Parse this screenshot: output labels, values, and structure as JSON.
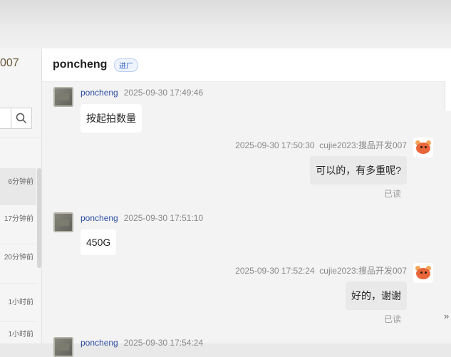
{
  "left_panel": {
    "title_fragment": "007",
    "conversations": [
      {
        "time": "6分钟前"
      },
      {
        "time": "17分钟前"
      },
      {
        "time": "20分钟前"
      },
      {
        "time": "1小时前"
      },
      {
        "time": "1小时前"
      }
    ]
  },
  "chat": {
    "title": "poncheng",
    "badge": "进厂",
    "messages": [
      {
        "sender": "poncheng",
        "time": "2025-09-30 17:49:46",
        "text": "按起拍数量"
      },
      {
        "sender": "cujie2023:搜品开发007",
        "time": "2025-09-30 17:50:30",
        "text": "可以的，有多重呢?",
        "status": "已读"
      },
      {
        "sender": "poncheng",
        "time": "2025-09-30 17:51:10",
        "text": "450G"
      },
      {
        "sender": "cujie2023:搜品开发007",
        "time": "2025-09-30 17:52:24",
        "text": "好的，谢谢",
        "status": "已读"
      },
      {
        "sender": "poncheng",
        "time": "2025-09-30 17:54:24",
        "text": ""
      }
    ]
  },
  "colors": {
    "accent": "#2c4da3",
    "bubble_self": "#e9e9e9",
    "bubble_other": "#ffffff"
  },
  "icons": {
    "search": "search-icon",
    "expand": "double-chevron-right-icon"
  }
}
